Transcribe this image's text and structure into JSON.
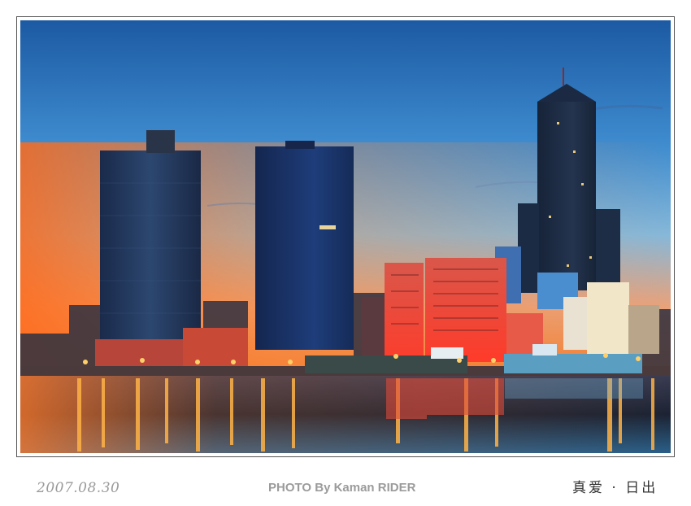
{
  "photo": {
    "subject": "harbor-skyline-at-dawn"
  },
  "captions": {
    "date": "2007.08.30",
    "credit": "PHOTO By Kaman RIDER",
    "title": "真爱 · 日出"
  },
  "colors": {
    "sky_top": "#1f5fa8",
    "sky_mid": "#5f9fd6",
    "horizon_orange": "#f08a3a",
    "water_dark": "#1b2230",
    "light_glow": "#ffb347"
  }
}
